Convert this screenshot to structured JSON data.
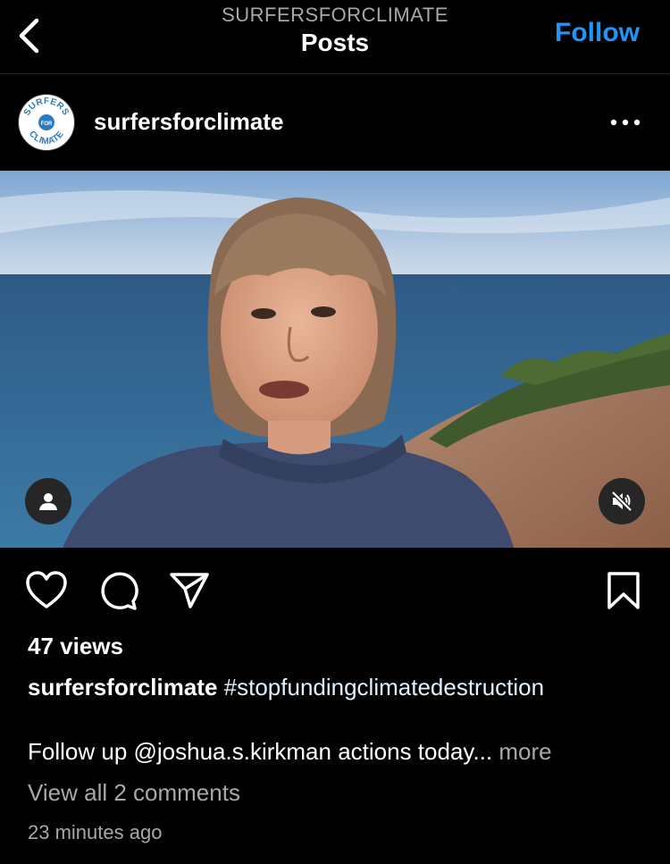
{
  "topbar": {
    "account": "SURFERSFORCLIMATE",
    "title": "Posts",
    "follow_label": "Follow",
    "back_icon": "chevron-left-icon"
  },
  "post": {
    "username": "surfersforclimate",
    "avatar_text": [
      "SURFERS",
      "FOR",
      "CLIMATE"
    ],
    "views": "47 views",
    "caption": {
      "user": "surfersforclimate",
      "hashtag": "#stopfundingclimatedestruction"
    },
    "description": {
      "prefix": "Follow up ",
      "mention": "@joshua.s.kirkman",
      "suffix": " actions today...",
      "more": " more"
    },
    "comments_label": "View all 2 comments",
    "timestamp": "23 minutes ago"
  },
  "icons": {
    "like": "heart-icon",
    "comment": "comment-icon",
    "share": "send-icon",
    "save": "bookmark-icon",
    "tag": "person-icon",
    "mute": "muted-speaker-icon",
    "options": "more-dots-icon"
  },
  "colors": {
    "background": "#000000",
    "accent": "#1e95f7",
    "secondary_text": "#a8a8a8",
    "avatar_brand": "#2a7bbf"
  }
}
